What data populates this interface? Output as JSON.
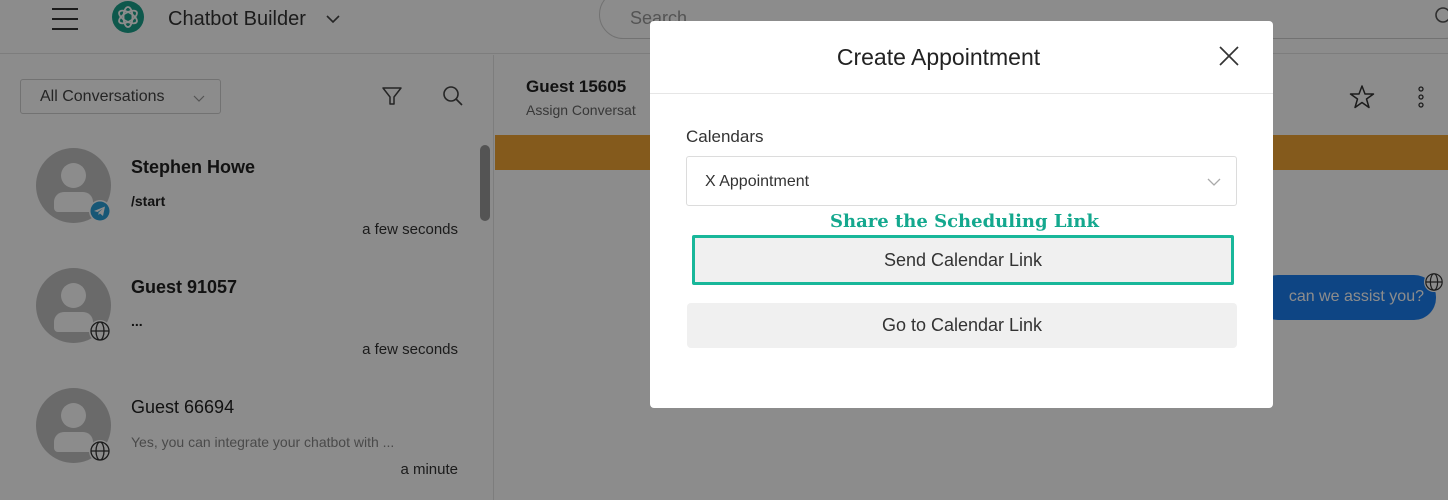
{
  "topbar": {
    "app_name": "Chatbot Builder",
    "search_placeholder": "Search"
  },
  "sidebar": {
    "filter_label": "All Conversations",
    "conversations": [
      {
        "name": "Stephen Howe",
        "message": "/start",
        "time": "a few seconds",
        "channel": "telegram"
      },
      {
        "name": "Guest 91057",
        "message": "...",
        "time": "a few seconds",
        "channel": "web"
      },
      {
        "name": "Guest 66694",
        "message": "Yes, you can integrate your chatbot with ...",
        "time": "a minute",
        "channel": "web"
      }
    ]
  },
  "chat": {
    "guest_name": "Guest 15605",
    "assign_text": "Assign Conversat",
    "bubble_text": "can we assist you?",
    "banner_color": "#f1a433",
    "bubble_color": "#1a7ef0"
  },
  "modal": {
    "title": "Create Appointment",
    "calendars_label": "Calendars",
    "calendar_selected": "X Appointment",
    "annotation": "Share the Scheduling Link",
    "send_label": "Send Calendar Link",
    "goto_label": "Go to Calendar Link",
    "highlight_color": "#19b79a"
  },
  "icons": {
    "menu": "hamburger-icon",
    "logo": "brand-logo",
    "filter": "funnel-icon",
    "search": "search-icon",
    "star": "star-icon",
    "more": "more-vertical-icon",
    "close": "close-icon"
  }
}
